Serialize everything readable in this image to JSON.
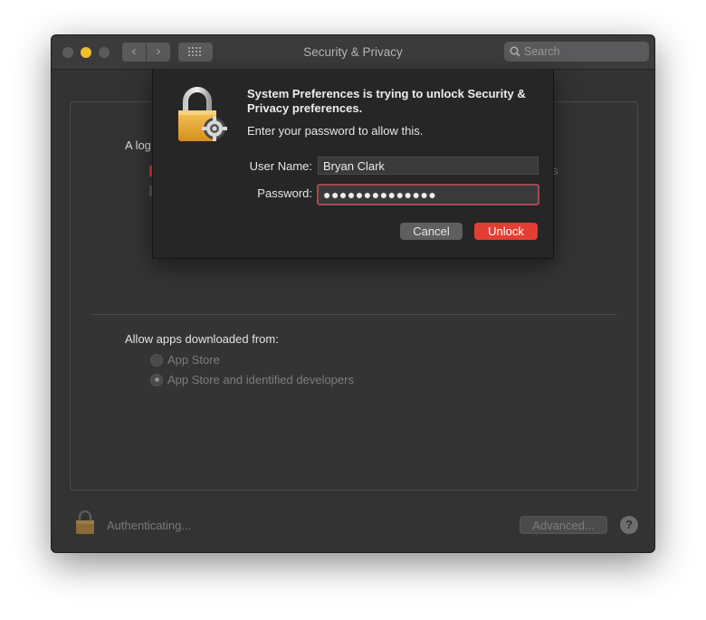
{
  "window": {
    "title": "Security & Privacy",
    "search_placeholder": "Search",
    "nav_back_glyph": "‹",
    "nav_fwd_glyph": "›"
  },
  "panel": {
    "partial_heading": "A log",
    "partial_suffix": "s",
    "allow_label": "Allow apps downloaded from:",
    "radio_options": [
      {
        "label": "App Store",
        "checked": false
      },
      {
        "label": "App Store and identified developers",
        "checked": true
      }
    ]
  },
  "footer": {
    "status_text": "Authenticating...",
    "advanced_label": "Advanced...",
    "help_label": "?"
  },
  "dialog": {
    "title": "System Preferences is trying to unlock Security & Privacy preferences.",
    "subtitle": "Enter your password to allow this.",
    "username_label": "User Name:",
    "username_value": "Bryan Clark",
    "password_label": "Password:",
    "password_value": "●●●●●●●●●●●●●●",
    "cancel_label": "Cancel",
    "unlock_label": "Unlock"
  },
  "colors": {
    "accent_unlock": "#e33e33",
    "focus_ring": "#a24a4f",
    "minimize": "#f2be30"
  },
  "icons": [
    "search-icon",
    "grid-icon",
    "padlock-icon",
    "lock-gear-icon"
  ]
}
